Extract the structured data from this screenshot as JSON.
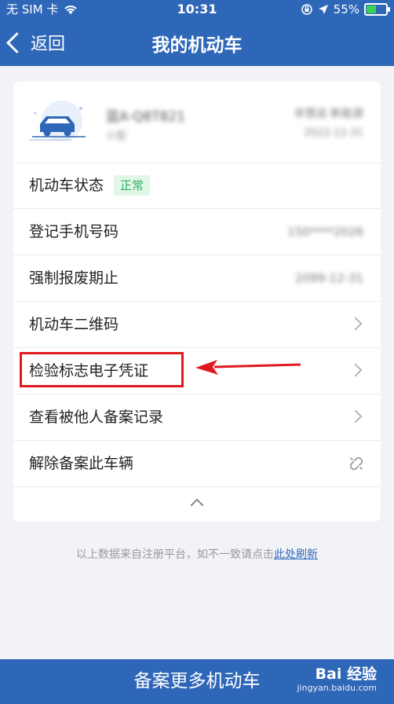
{
  "status_bar": {
    "carrier": "无 SIM 卡",
    "time": "10:31",
    "battery": "55%",
    "battery_level": 0.55
  },
  "nav": {
    "back_label": "返回",
    "title": "我的机动车"
  },
  "vehicle": {
    "plate": "蓝A·Q8T821",
    "plate_sub": "小型",
    "type": "非营运 新能源",
    "date": "2022-12-31"
  },
  "rows": [
    {
      "label": "机动车状态",
      "badge": "正常"
    },
    {
      "label": "登记手机号码",
      "value": "150****2026"
    },
    {
      "label": "强制报废期止",
      "value": "2099-12-31"
    },
    {
      "label": "机动车二维码"
    },
    {
      "label": "检验标志电子凭证"
    },
    {
      "label": "查看被他人备案记录"
    },
    {
      "label": "解除备案此车辆"
    }
  ],
  "note": {
    "text": "以上数据来自注册平台，如不一致请点击",
    "link": "此处刷新"
  },
  "footer": {
    "button_label": "备案更多机动车",
    "watermark_main": "Bai 经验",
    "watermark_sub": "jingyan.baidu.com"
  },
  "colors": {
    "brand": "#2f67b8",
    "status_ok": "#2bb060",
    "highlight": "#e0191f"
  },
  "icons": [
    "wifi-icon",
    "lock-rotation-icon",
    "location-arrow-icon",
    "battery-icon",
    "back-chevron-icon",
    "car-icon",
    "chevron-right-icon",
    "unlink-icon",
    "chevron-up-icon"
  ]
}
